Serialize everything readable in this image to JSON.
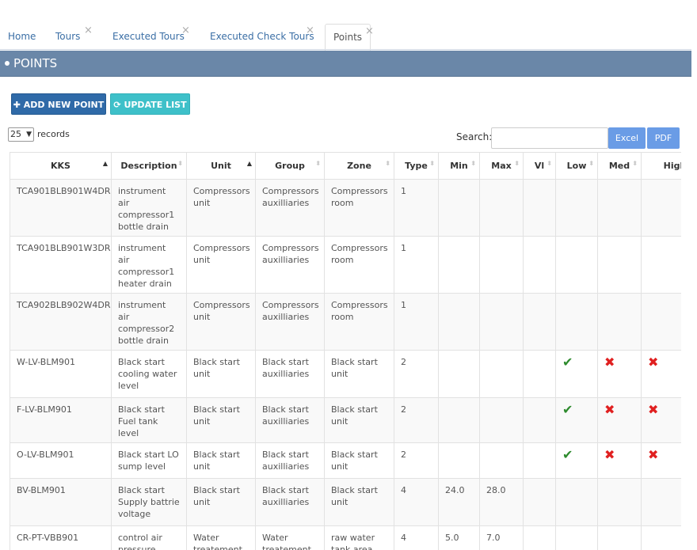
{
  "tabs": [
    {
      "label": "Home",
      "closable": false
    },
    {
      "label": "Tours",
      "closable": true
    },
    {
      "label": "Executed Tours",
      "closable": true
    },
    {
      "label": "Executed Check Tours",
      "closable": true
    },
    {
      "label": "Points",
      "closable": true,
      "active": true
    }
  ],
  "close_glyph": "×",
  "panel": {
    "title": "POINTS"
  },
  "actions": {
    "add_label": "ADD NEW POINT",
    "update_label": "UPDATE LIST"
  },
  "length": {
    "value": "25",
    "suffix": "records"
  },
  "search": {
    "label": "Search:",
    "value": ""
  },
  "export": {
    "excel": "Excel",
    "pdf": "PDF"
  },
  "table": {
    "columns": [
      "KKS",
      "Description",
      "Unit",
      "Group",
      "Zone",
      "Type",
      "Min",
      "Max",
      "Vl",
      "Low",
      "Med",
      "High"
    ],
    "sorted_columns": [
      "KKS",
      "Unit"
    ],
    "rows": [
      {
        "kks": "TCA901BLB901W4DR",
        "description": "instrument air compressor1 bottle drain",
        "unit": "Compressors unit",
        "group": "Compressors auxilliaries",
        "zone": "Compressors room",
        "type": "1",
        "min": "",
        "max": "",
        "vl": "",
        "low": null,
        "med": null,
        "high": null
      },
      {
        "kks": "TCA901BLB901W3DR",
        "description": "instrument air compressor1 heater drain",
        "unit": "Compressors unit",
        "group": "Compressors auxilliaries",
        "zone": "Compressors room",
        "type": "1",
        "min": "",
        "max": "",
        "vl": "",
        "low": null,
        "med": null,
        "high": null
      },
      {
        "kks": "TCA902BLB902W4DR",
        "description": "instrument air compressor2 bottle drain",
        "unit": "Compressors unit",
        "group": "Compressors auxilliaries",
        "zone": "Compressors room",
        "type": "1",
        "min": "",
        "max": "",
        "vl": "",
        "low": null,
        "med": null,
        "high": null
      },
      {
        "kks": "W-LV-BLM901",
        "description": "Black start cooling water level",
        "unit": "Black start unit",
        "group": "Black start auxilliaries",
        "zone": "Black start unit",
        "type": "2",
        "min": "",
        "max": "",
        "vl": "",
        "low": true,
        "med": false,
        "high": false
      },
      {
        "kks": "F-LV-BLM901",
        "description": "Black start Fuel tank level",
        "unit": "Black start unit",
        "group": "Black start auxilliaries",
        "zone": "Black start unit",
        "type": "2",
        "min": "",
        "max": "",
        "vl": "",
        "low": true,
        "med": false,
        "high": false
      },
      {
        "kks": "O-LV-BLM901",
        "description": "Black start LO sump level",
        "unit": "Black start unit",
        "group": "Black start auxilliaries",
        "zone": "Black start unit",
        "type": "2",
        "min": "",
        "max": "",
        "vl": "",
        "low": true,
        "med": false,
        "high": false
      },
      {
        "kks": "BV-BLM901",
        "description": "Black start Supply battrie voltage",
        "unit": "Black start unit",
        "group": "Black start auxilliaries",
        "zone": "Black start unit",
        "type": "4",
        "min": "24.0",
        "max": "28.0",
        "vl": "",
        "low": null,
        "med": null,
        "high": null
      },
      {
        "kks": "CR-PT-VBB901",
        "description": "control air pressure",
        "unit": "Water treatement unit",
        "group": "Water treatement unit",
        "zone": "raw water tank area",
        "type": "4",
        "min": "5.0",
        "max": "7.0",
        "vl": "",
        "low": null,
        "med": null,
        "high": null
      }
    ]
  },
  "colors": {
    "header": "#6a87a8",
    "add_button": "#2f6aa8",
    "update_button": "#3ec0c9",
    "export_button": "#6a9ce6",
    "check": "#2e8b2e",
    "cross": "#e02020"
  }
}
